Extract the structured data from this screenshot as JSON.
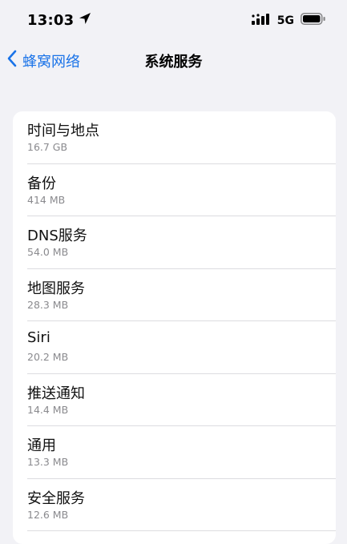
{
  "status_bar": {
    "time": "13:03",
    "network": "5G"
  },
  "nav": {
    "back_label": "蜂窝网络",
    "title": "系统服务"
  },
  "services": [
    {
      "name": "时间与地点",
      "size": "16.7 GB"
    },
    {
      "name": "备份",
      "size": "414 MB"
    },
    {
      "name": "DNS服务",
      "size": "54.0 MB"
    },
    {
      "name": "地图服务",
      "size": "28.3 MB"
    },
    {
      "name": "Siri",
      "size": "20.2 MB"
    },
    {
      "name": "推送通知",
      "size": "14.4 MB"
    },
    {
      "name": "通用",
      "size": "13.3 MB"
    },
    {
      "name": "安全服务",
      "size": "12.6 MB"
    }
  ],
  "colors": {
    "accent": "#1a73e8",
    "background": "#f2f2f6",
    "card": "#ffffff",
    "secondary_text": "#8a8a8e"
  }
}
